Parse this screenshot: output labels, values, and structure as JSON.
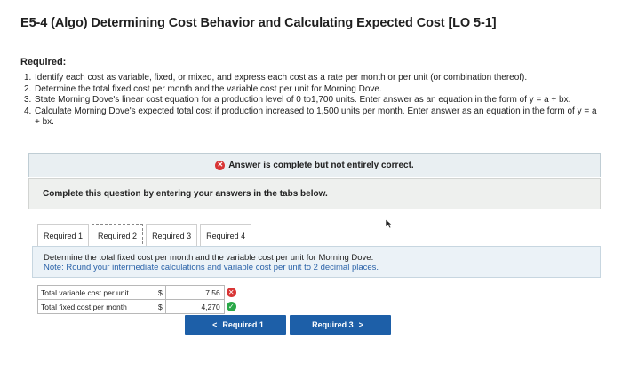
{
  "title": "E5-4 (Algo) Determining Cost Behavior and Calculating Expected Cost [LO 5-1]",
  "required_heading": "Required:",
  "requirements": [
    {
      "num": "1.",
      "text": "Identify each cost as variable, fixed, or mixed, and express each cost as a rate per month or per unit (or combination thereof)."
    },
    {
      "num": "2.",
      "text": "Determine the total fixed cost per month and the variable cost per unit for Morning Dove."
    },
    {
      "num": "3.",
      "text": "State Morning Dove's linear cost equation for a production level of 0 to1,700 units. Enter answer as an equation in the form of y = a + bx."
    },
    {
      "num": "4.",
      "text": "Calculate Morning Dove's expected total cost if production increased to 1,500 units per month. Enter answer as an equation in the form of y = a + bx."
    }
  ],
  "banner": "Answer is complete but not entirely correct.",
  "instruction": "Complete this question by entering your answers in the tabs below.",
  "tabs": [
    "Required 1",
    "Required 2",
    "Required 3",
    "Required 4"
  ],
  "question": "Determine the total fixed cost per month and the variable cost per unit for Morning Dove.",
  "note": "Note: Round your intermediate calculations and variable cost per unit to 2 decimal places.",
  "answers": [
    {
      "label": "Total variable cost per unit",
      "currency": "$",
      "value": "7.56",
      "status": "incorrect"
    },
    {
      "label": "Total fixed cost per month",
      "currency": "$",
      "value": "4,270",
      "status": "correct"
    }
  ],
  "nav": {
    "prev_label": "Required 1",
    "next_label": "Required 3"
  },
  "colors": {
    "accent": "#1d5fa8",
    "incorrect": "#d83535",
    "correct": "#2aa848"
  }
}
